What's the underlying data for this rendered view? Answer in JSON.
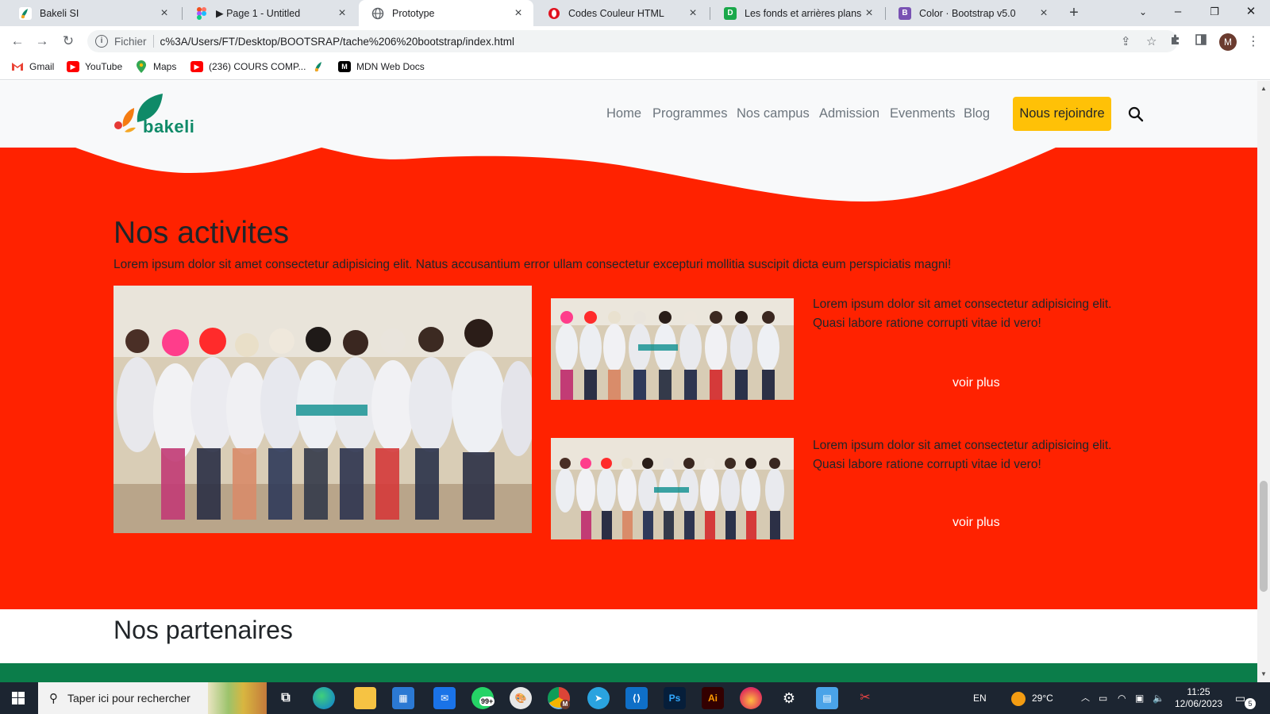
{
  "browser": {
    "tabs": [
      {
        "title": "Bakeli SI",
        "icon": "bakeli-favicon"
      },
      {
        "title": "▶ Page 1 - Untitled",
        "icon": "figma-favicon"
      },
      {
        "title": "Prototype",
        "icon": "globe-favicon"
      },
      {
        "title": "Codes Couleur HTML",
        "icon": "opera-favicon"
      },
      {
        "title": "Les fonds et arrières plans CSS",
        "icon": "d-favicon"
      },
      {
        "title": "Color · Bootstrap v5.0",
        "icon": "bootstrap-favicon"
      }
    ],
    "active_tab": 2,
    "address": {
      "scheme_label": "Fichier",
      "url": "c%3A/Users/FT/Desktop/BOOTSRAP/tache%206%20bootstrap/index.html"
    },
    "profile_initial": "M",
    "bookmarks": [
      {
        "label": "Gmail",
        "icon": "gmail-icon"
      },
      {
        "label": "YouTube",
        "icon": "youtube-icon"
      },
      {
        "label": "Maps",
        "icon": "maps-icon"
      },
      {
        "label": "(236) COURS COMP...",
        "icon": "youtube-icon"
      },
      {
        "label": "",
        "icon": "bakeli-icon"
      },
      {
        "label": "MDN Web Docs",
        "icon": "mdn-icon"
      }
    ]
  },
  "site": {
    "logo_text": "bakeli",
    "nav": [
      "Home",
      "Programmes",
      "Nos campus",
      "Admission",
      "Evenments",
      "Blog"
    ],
    "cta_label": "Nous rejoindre",
    "activities": {
      "title": "Nos activites",
      "lead": "Lorem ipsum dolor sit amet consectetur adipisicing elit. Natus accusantium error ullam consectetur excepturi mollitia suscipit dicta eum perspiciatis magni!",
      "cards": [
        {
          "text": "Lorem ipsum dolor sit amet consectetur adipisicing elit. Quasi labore ratione corrupti vitae id vero!",
          "link": "voir plus"
        },
        {
          "text": "Lorem ipsum dolor sit amet consectetur adipisicing elit. Quasi labore ratione corrupti vitae id vero!",
          "link": "voir plus"
        }
      ]
    },
    "partners_title": "Nos partenaires"
  },
  "taskbar": {
    "search_placeholder": "Taper ici pour rechercher",
    "apps": [
      "task-view",
      "edge",
      "file-explorer",
      "store",
      "mail",
      "whatsapp",
      "paint",
      "chrome",
      "telegram",
      "vscode",
      "photoshop",
      "illustrator",
      "firefox",
      "settings",
      "control-panel",
      "snipping-tool"
    ],
    "whatsapp_badge": "99+",
    "chrome_badge": "M",
    "ps_label": "Ps",
    "ai_label": "Ai",
    "language": "EN",
    "temperature": "29°C",
    "time": "11:25",
    "date": "12/06/2023",
    "notifications": "5"
  },
  "colors": {
    "activities_bg": "#ff2200",
    "cta_bg": "#ffc107",
    "brand_green": "#0f8a68",
    "partners_strip": "#0b7d4a"
  }
}
